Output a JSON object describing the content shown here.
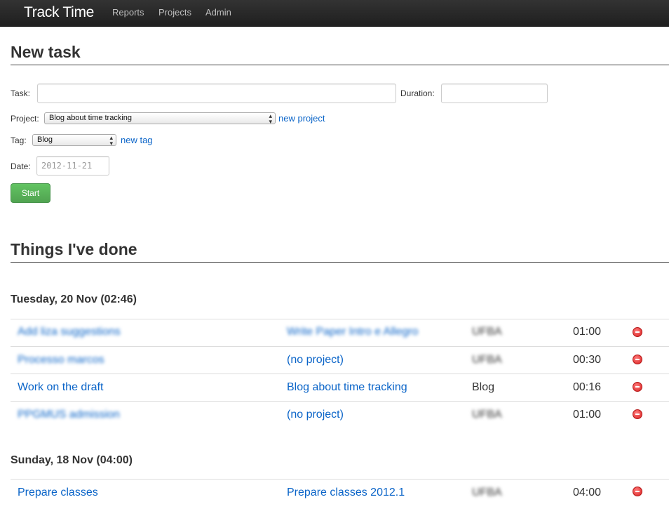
{
  "nav": {
    "brand": "Track Time",
    "links": [
      "Reports",
      "Projects",
      "Admin"
    ]
  },
  "new_task": {
    "heading": "New task",
    "task_label": "Task:",
    "task_value": "",
    "duration_label": "Duration:",
    "duration_value": "",
    "project_label": "Project:",
    "project_selected": "Blog about time tracking",
    "new_project_link": "new project",
    "tag_label": "Tag:",
    "tag_selected": "Blog",
    "new_tag_link": "new tag",
    "date_label": "Date:",
    "date_placeholder": "2012-11-21",
    "start_button": "Start"
  },
  "done": {
    "heading": "Things I've done",
    "days": [
      {
        "title": "Tuesday, 20 Nov (02:46)",
        "rows": [
          {
            "task": "Add liza suggestions",
            "project": "Write Paper Intro e Allegro",
            "tag": "UFBA",
            "duration": "01:00",
            "task_blurred": true,
            "project_blurred": true,
            "tag_blurred": true
          },
          {
            "task": "Processo marcos",
            "project": "(no project)",
            "tag": "UFBA",
            "duration": "00:30",
            "task_blurred": true,
            "project_blurred": false,
            "tag_blurred": true
          },
          {
            "task": "Work on the draft",
            "project": "Blog about time tracking",
            "tag": "Blog",
            "duration": "00:16",
            "task_blurred": false,
            "project_blurred": false,
            "tag_blurred": false
          },
          {
            "task": "PPGMUS admission",
            "project": "(no project)",
            "tag": "UFBA",
            "duration": "01:00",
            "task_blurred": true,
            "project_blurred": false,
            "tag_blurred": true
          }
        ]
      },
      {
        "title": "Sunday, 18 Nov (04:00)",
        "rows": [
          {
            "task": "Prepare classes",
            "project": "Prepare classes 2012.1",
            "tag": "UFBA",
            "duration": "04:00",
            "task_blurred": false,
            "project_blurred": false,
            "tag_blurred": true
          }
        ]
      }
    ]
  },
  "colors": {
    "link": "#0a64c8",
    "start_button": "#5bb75b",
    "delete_icon": "#d82020"
  },
  "icons": {
    "delete": "remove-circle-icon",
    "select": "chevron-updown-icon"
  }
}
